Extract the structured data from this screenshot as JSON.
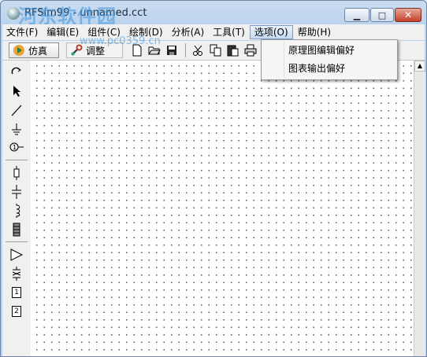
{
  "window": {
    "title": "RFSim99 - unnamed.cct",
    "watermark": "河东软件园",
    "watermark_url": "www.pc0359.cn",
    "controls": {
      "minimize": "▁",
      "maximize": "□",
      "close": "✕"
    }
  },
  "menubar": {
    "items": [
      {
        "label": "文件(F)"
      },
      {
        "label": "编辑(E)"
      },
      {
        "label": "组件(C)"
      },
      {
        "label": "绘制(D)"
      },
      {
        "label": "分析(A)"
      },
      {
        "label": "工具(T)"
      },
      {
        "label": "选项(O)"
      },
      {
        "label": "帮助(H)"
      }
    ],
    "active": "选项(O)"
  },
  "toolbar": {
    "simulate_label": "仿真",
    "simulate_icon": "play-icon",
    "tune_label": "调整",
    "tune_icon": "wrench-icon",
    "icons": [
      "new-file-icon",
      "open-folder-icon",
      "save-disk-icon",
      "cut-icon",
      "copy-icon",
      "paste-icon",
      "print-icon"
    ]
  },
  "options_menu": {
    "items": [
      {
        "label": "原理图编辑偏好"
      },
      {
        "label": "图表输出偏好"
      }
    ]
  },
  "palette": {
    "tools": [
      "rotate-icon",
      "pointer-icon",
      "wire-icon",
      "ground-icon",
      "port-icon",
      "resistor-icon",
      "capacitor-icon",
      "inductor-icon",
      "transformer-icon",
      "amplifier-icon",
      "crystal-icon",
      "one-port-block-icon",
      "two-port-block-icon"
    ],
    "block_1_label": "1",
    "block_2_label": "2"
  }
}
